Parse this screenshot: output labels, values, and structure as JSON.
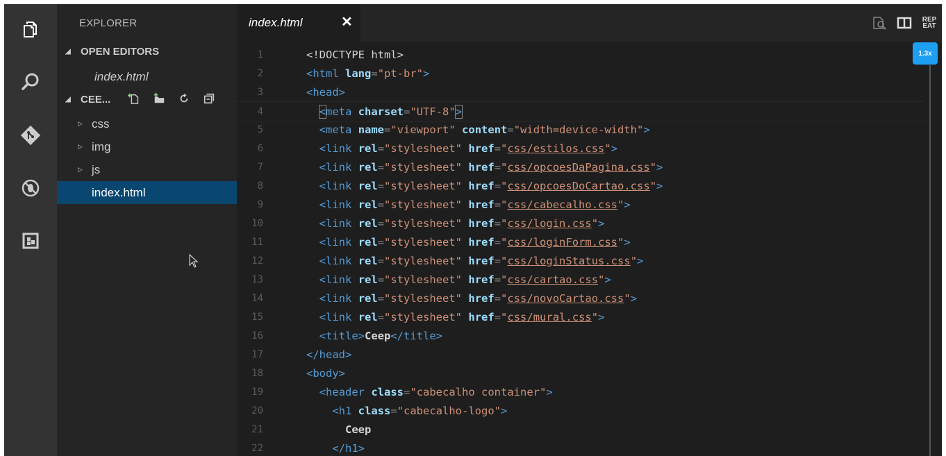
{
  "sidebar": {
    "title": "EXPLORER",
    "open_editors_label": "OPEN EDITORS",
    "open_editor_file": "index.html",
    "project_label": "CEE...",
    "tree": [
      {
        "label": "css",
        "type": "folder"
      },
      {
        "label": "img",
        "type": "folder"
      },
      {
        "label": "js",
        "type": "folder"
      },
      {
        "label": "index.html",
        "type": "file",
        "selected": true
      }
    ]
  },
  "activity_icons": [
    "files-icon",
    "search-icon",
    "git-icon",
    "debug-icon",
    "extensions-icon"
  ],
  "editor": {
    "tab_label": "index.html",
    "tab_close": "✕",
    "repeat_label_1": "REP",
    "repeat_label_2": "EAT",
    "zoom": "1.3x",
    "line_numbers": [
      "1",
      "2",
      "3",
      "4",
      "5",
      "6",
      "7",
      "8",
      "9",
      "10",
      "11",
      "12",
      "13",
      "14",
      "15",
      "16",
      "17",
      "18",
      "19",
      "20",
      "21",
      "22"
    ],
    "code": {
      "l1": "<!DOCTYPE html>",
      "l2_tag": "<html",
      "l2_attr": "lang",
      "l2_val": "\"pt-br\"",
      "l3": "<head>",
      "l4_attr": "charset",
      "l4_val": "\"UTF-8\"",
      "l5_attr1": "name",
      "l5_val1": "\"viewport\"",
      "l5_attr2": "content",
      "l5_val2": "\"width=device-width\"",
      "stylesheets": [
        "css/estilos.css",
        "css/opcoesDaPagina.css",
        "css/opcoesDoCartao.css",
        "css/cabecalho.css",
        "css/login.css",
        "css/loginForm.css",
        "css/loginStatus.css",
        "css/cartao.css",
        "css/novoCartao.css",
        "css/mural.css"
      ],
      "title_text": "Ceep",
      "l19_val": "\"cabecalho container\"",
      "l20_val": "\"cabecalho-logo\"",
      "l21_text": "Ceep"
    }
  }
}
